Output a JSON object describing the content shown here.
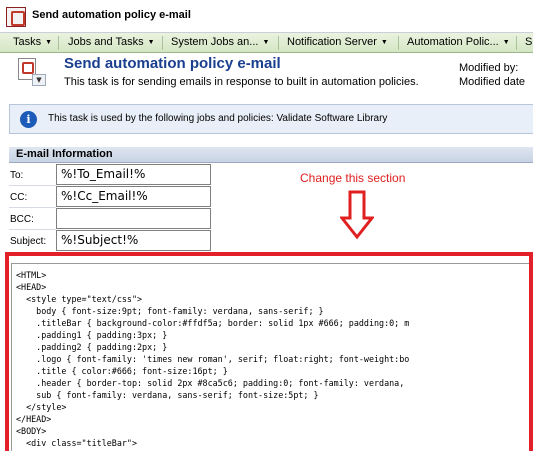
{
  "window": {
    "title": "Send automation policy e-mail"
  },
  "menu": [
    {
      "label": "Tasks"
    },
    {
      "label": "Jobs and Tasks"
    },
    {
      "label": "System Jobs an..."
    },
    {
      "label": "Notification Server"
    },
    {
      "label": "Automation Polic..."
    },
    {
      "label": "S"
    }
  ],
  "header": {
    "title": "Send automation policy e-mail",
    "subtitle": "This task is for sending emails in response to built in automation policies.",
    "modified_by_label": "Modified by:",
    "modified_date_label": "Modified date"
  },
  "info_banner": {
    "text": "This task is used by the following jobs and policies: Validate Software Library"
  },
  "form": {
    "section_title": "E-mail Information",
    "fields": [
      {
        "label": "To:",
        "value": "%!To_Email!%"
      },
      {
        "label": "CC:",
        "value": "%!Cc_Email!%"
      },
      {
        "label": "BCC:",
        "value": ""
      },
      {
        "label": "Subject:",
        "value": "%!Subject!%"
      }
    ]
  },
  "annotation": {
    "text": "Change this section",
    "color": "#e02020"
  },
  "body_editor": {
    "lines": [
      "<HTML>",
      "<HEAD>",
      "  <style type=\"text/css\">",
      "    body { font-size:9pt; font-family: verdana, sans-serif; }",
      "    .titleBar { background-color:#ffdf5a; border: solid 1px #666; padding:0; m",
      "    .padding1 { padding:3px; }",
      "    .padding2 { padding:2px; }",
      "    .logo { font-family: 'times new roman', serif; float:right; font-weight:bo",
      "    .title { color:#666; font-size:16pt; }",
      "    .header { border-top: solid 2px #8ca5c6; padding:0; font-family: verdana,",
      "    sub { font-family: verdana, sans-serif; font-size:5pt; }",
      "  </style>",
      "</HEAD>",
      "<BODY>",
      "  <div class=\"titleBar\">"
    ]
  }
}
